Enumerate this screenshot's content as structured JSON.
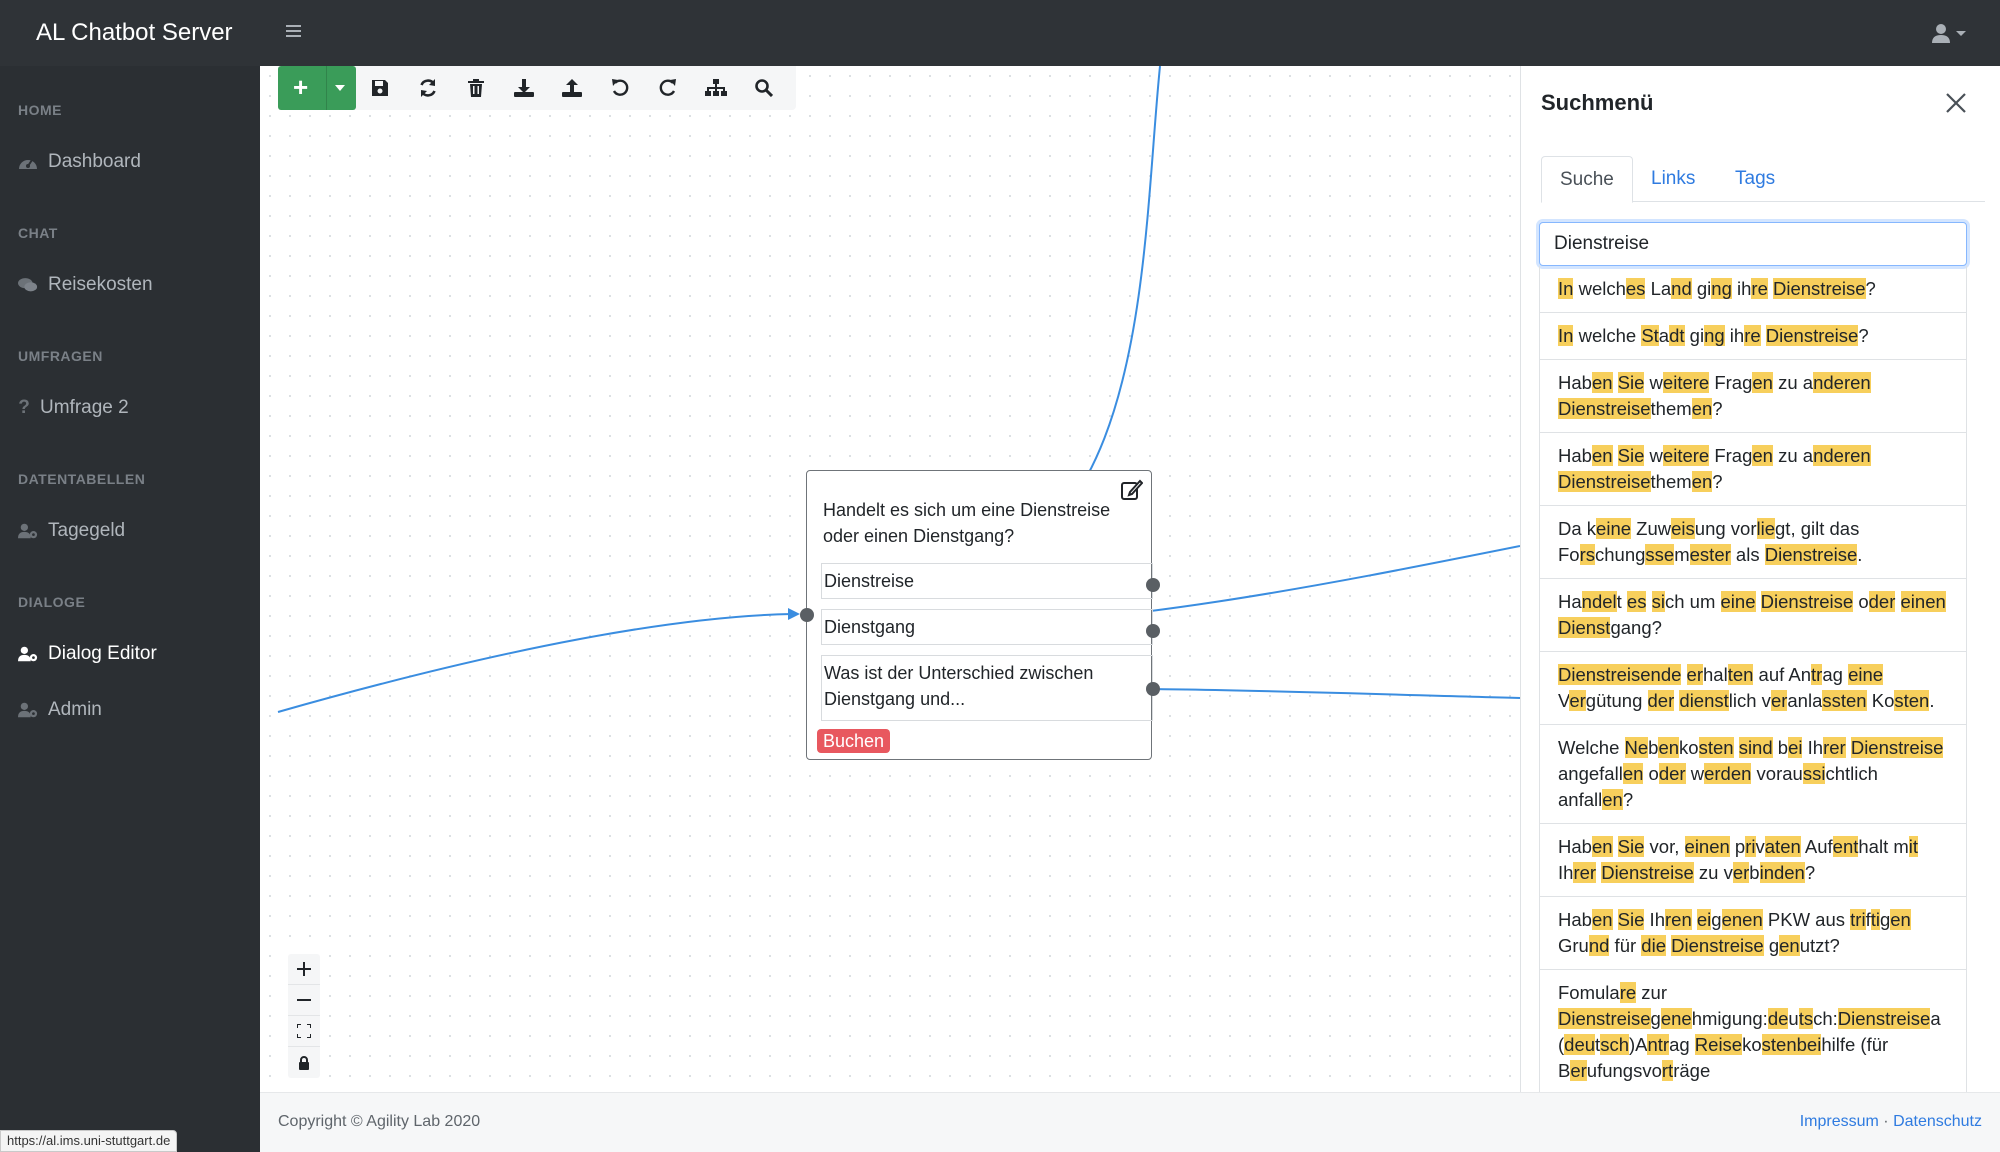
{
  "app": {
    "title": "AL Chatbot Server"
  },
  "colors": {
    "accent": "#2f7be0",
    "add_button": "#3a9c59",
    "tag_badge": "#e8585f",
    "highlight": "#f7cf5c",
    "edge": "#3a8de0"
  },
  "sidebar": {
    "sections": [
      {
        "header": "HOME",
        "items": [
          {
            "label": "Dashboard",
            "icon": "dashboard-icon"
          }
        ]
      },
      {
        "header": "CHAT",
        "items": [
          {
            "label": "Reisekosten",
            "icon": "comments-icon"
          }
        ]
      },
      {
        "header": "UMFRAGEN",
        "items": [
          {
            "label": "Umfrage 2",
            "icon": "question-icon"
          }
        ]
      },
      {
        "header": "DATENTABELLEN",
        "items": [
          {
            "label": "Tagegeld",
            "icon": "users-cog-icon"
          }
        ]
      },
      {
        "header": "DIALOGE",
        "items": [
          {
            "label": "Dialog Editor",
            "icon": "users-cog-icon",
            "active": true
          },
          {
            "label": "Admin",
            "icon": "users-cog-icon"
          }
        ]
      }
    ]
  },
  "status_url": "https://al.ims.uni-stuttgart.de",
  "toolbar": {
    "buttons": [
      "add-icon",
      "save-icon",
      "refresh-icon",
      "trash-icon",
      "download-icon",
      "upload-icon",
      "undo-icon",
      "redo-icon",
      "sitemap-icon",
      "search-icon"
    ]
  },
  "zoom_controls": [
    "zoom-in-icon",
    "zoom-out-icon",
    "fit-view-icon",
    "lock-icon"
  ],
  "node": {
    "question": "Handelt es sich um eine Dienstreise oder einen Dienstgang?",
    "answers": [
      "Dienstreise",
      "Dienstgang",
      "Was ist der Unterschied zwischen Dienstgang und..."
    ],
    "tag": "Buchen"
  },
  "panel": {
    "title": "Suchmenü",
    "tabs": [
      {
        "label": "Suche",
        "active": true
      },
      {
        "label": "Links"
      },
      {
        "label": "Tags"
      }
    ],
    "search_value": "Dienstreise",
    "results": [
      "[In] welch[es] La[nd] gi[ng] ih[re] [Dienstreise]?",
      "[In] welche [St]a[dt] gi[ng] ih[re] [Dienstreise]?",
      "Hab[en] [Sie] w[eitere] Frag[en] zu a[nderen] [Dienstreise]them[en]?",
      "Hab[en] [Sie] w[eitere] Frag[en] zu a[nderen] [Dienstreise]them[en]?",
      "Da k[eine] Zuw[eis]ung vor[lie]gt, gilt das Fo[rs]chung[sse]m[ester] als [Dienstreise].",
      "Ha[ndel]t [es] [si]ch um [eine] [Dienstreise] o[der] [einen] [Dienst]gang?",
      "[Dienstreisende] [er]hal[ten] auf An[tr]ag [eine] V[er]gütung [der] [dienst]lich v[er]anla[ssten] Ko[sten].",
      "Welche [Ne]b[en]ko[sten] [sind] b[ei] Ih[rer] [Dienstreise] angefall[en] o[der] w[erden] vorau[ssi]chtlich anfall[en]?",
      "Hab[en] [Sie] vor, [einen] p[ri]v[aten] Auf[ent]halt m[it] Ih[rer] [Dienstreise] zu v[er]b[inden]?",
      "Hab[en] [Sie] Ih[ren] [ei]g[enen] PKW aus [tri]f[ti]g[en] Gru[nd] für [die] [Dienstreise] g[en]utzt?",
      "Fomula[re] zur [Dienstreise]g[ene]hmigung:[de]u[ts]ch:[Dienstreise]a ([deu]t[sch])A[ntr]ag [Reise]ko[sten][bei]hilfe (für B[er]ufungsvo[rt]räge"
    ]
  },
  "footer": {
    "copyright": "Copyright © Agility Lab 2020",
    "links": [
      "Impressum",
      "Datenschutz"
    ],
    "separator": "·"
  }
}
